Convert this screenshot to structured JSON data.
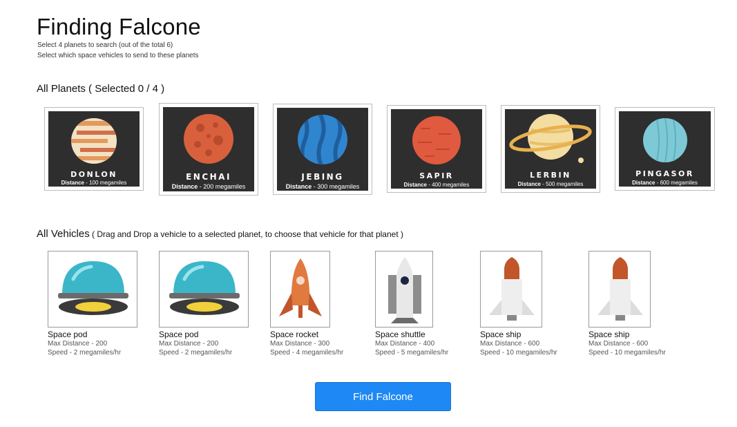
{
  "header": {
    "title": "Finding Falcone",
    "subtitle_1": "Select 4 planets to search (out of the total 6)",
    "subtitle_2": "Select which space vehicles to send to these planets"
  },
  "planets_section": {
    "heading": "All Planets ( Selected 0 / 4 )",
    "planets": [
      {
        "name": "DONLON",
        "distance_label": "Distance",
        "distance_value": "- 100 megamiles",
        "icon": "striped-planet-icon"
      },
      {
        "name": "ENCHAI",
        "distance_label": "Distance",
        "distance_value": "- 200 megamiles",
        "icon": "cratered-planet-icon"
      },
      {
        "name": "JEBING",
        "distance_label": "Distance",
        "distance_value": "- 300 megamiles",
        "icon": "wavy-blue-planet-icon"
      },
      {
        "name": "SAPIR",
        "distance_label": "Distance",
        "distance_value": "- 400 megamiles",
        "icon": "red-planet-icon"
      },
      {
        "name": "LERBIN",
        "distance_label": "Distance",
        "distance_value": "- 500 megamiles",
        "icon": "ringed-planet-icon"
      },
      {
        "name": "PINGASOR",
        "distance_label": "Distance",
        "distance_value": "- 600 megamiles",
        "icon": "ice-planet-icon"
      }
    ]
  },
  "vehicles_section": {
    "heading": "All Vehicles",
    "hint": " ( Drag and Drop a vehicle to a selected planet, to choose that vehicle for that planet )",
    "vehicles": [
      {
        "name": "Space pod",
        "max_distance": "Max Distance - 200",
        "speed": "Speed - 2 megamiles/hr",
        "icon": "space-pod-icon"
      },
      {
        "name": "Space pod",
        "max_distance": "Max Distance - 200",
        "speed": "Speed - 2 megamiles/hr",
        "icon": "space-pod-icon"
      },
      {
        "name": "Space rocket",
        "max_distance": "Max Distance - 300",
        "speed": "Speed - 4 megamiles/hr",
        "icon": "space-rocket-icon"
      },
      {
        "name": "Space shuttle",
        "max_distance": "Max Distance - 400",
        "speed": "Speed - 5 megamiles/hr",
        "icon": "space-shuttle-icon"
      },
      {
        "name": "Space ship",
        "max_distance": "Max Distance - 600",
        "speed": "Speed - 10 megamiles/hr",
        "icon": "space-ship-icon"
      },
      {
        "name": "Space ship",
        "max_distance": "Max Distance - 600",
        "speed": "Speed - 10 megamiles/hr",
        "icon": "space-ship-icon"
      }
    ]
  },
  "actions": {
    "find_label": "Find Falcone",
    "accent_color": "#1e88f5"
  }
}
